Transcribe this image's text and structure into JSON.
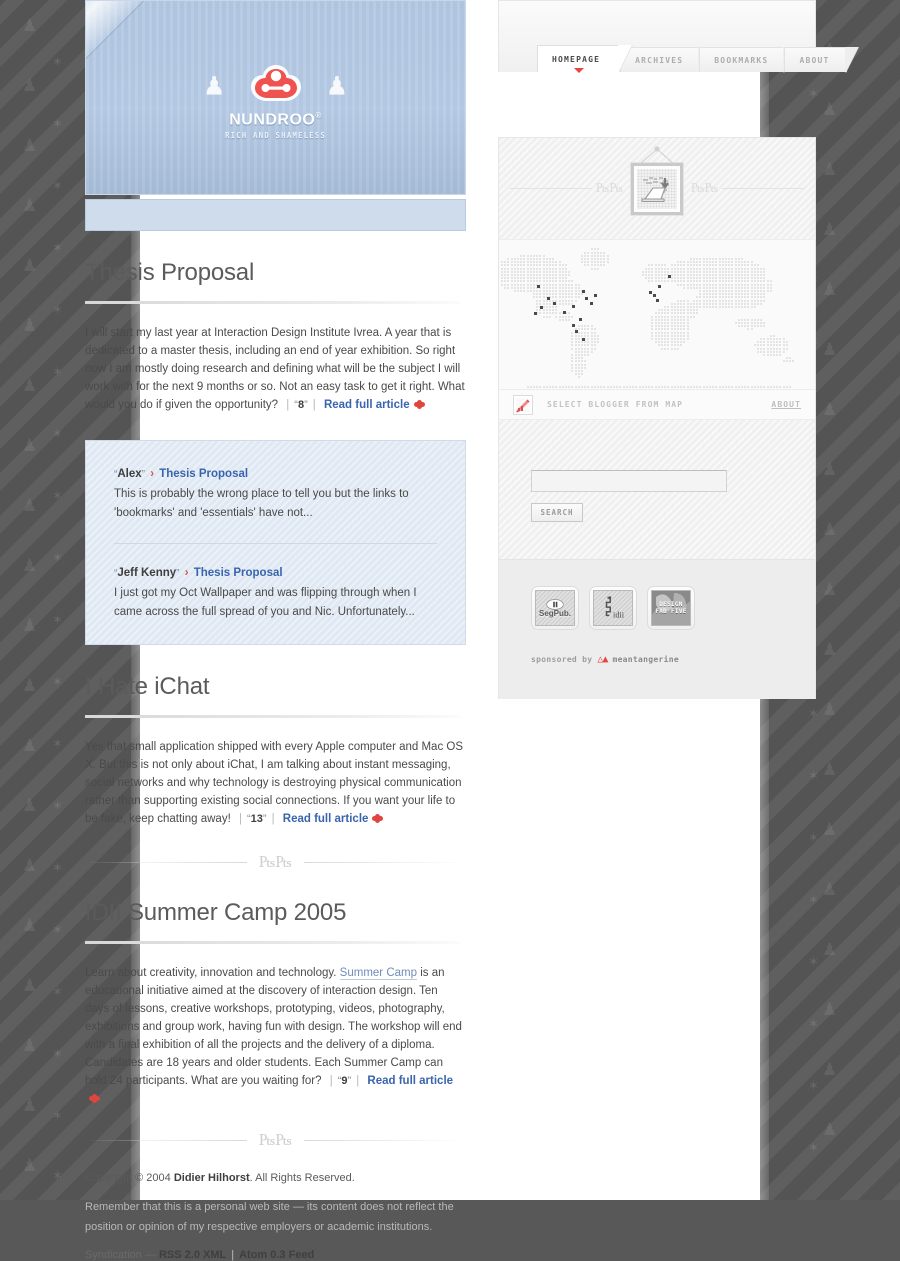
{
  "site": {
    "banner": {
      "logo_name": "NUNDROO",
      "logo_trademark": "®",
      "logo_tagline": "RICH AND SHAMELESS"
    }
  },
  "nav": {
    "tabs": [
      {
        "label": "HOMEPAGE",
        "active": true
      },
      {
        "label": "ARCHIVES",
        "active": false
      },
      {
        "label": "BOOKMARKS",
        "active": false
      },
      {
        "label": "ABOUT",
        "active": false
      }
    ]
  },
  "articles": [
    {
      "title": "Thesis Proposal",
      "body": "I will start my last year at Interaction Design Institute Ivrea. A year that is dedicated to a master thesis, including an end of year exhibition. So right now I am mostly doing research and defining what will be the subject I will work with for the next 9 months or so. Not an easy task to get it right. What would you do if given the opportunity?",
      "comment_count": "8",
      "read_more": "Read full article"
    },
    {
      "title": "I Hate iChat",
      "body": "Yes that small application shipped with every Apple computer and Mac OS X. But this is not only about iChat, I am talking about instant messaging, social networks and why technology is destroying physical communication rather than supporting existing social connections. If you want your life to be fake, keep chatting away!",
      "comment_count": "13",
      "read_more": "Read full article"
    },
    {
      "title": "IDII Summer Camp 2005",
      "body_part1": "Learn about creativity, innovation and technology. ",
      "body_link": "Summer Camp",
      "body_part2": " is an educational initiative aimed at the discovery of interaction design. Ten days of lessons, creative workshops, prototyping, videos, photography, exhibitions and group work, having fun with design. The workshop will end with a final exhibition of all the projects and the delivery of a diploma. Candidates are 18 years and older students. Each Summer Camp can hold 24 participants. What are you waiting for?",
      "comment_count": "9",
      "read_more": "Read full article"
    }
  ],
  "comments": [
    {
      "author": "Alex",
      "arrow": "›",
      "post": "Thesis Proposal",
      "excerpt": "This is probably the wrong place to tell you but the links to 'bookmarks' and 'essentials' have not..."
    },
    {
      "author": "Jeff Kenny",
      "arrow": "›",
      "post": "Thesis Proposal",
      "excerpt": "I just got my Oct Wallpaper and was flipping through when I came across the full spread of you and Nic. Unfortunately..."
    }
  ],
  "footer": {
    "copyright_prefix": "Copyright © 2004 ",
    "copyright_name": "Didier Hilhorst",
    "copyright_suffix": ". All Rights Reserved.",
    "disclaimer": "Remember that this is a personal web site — its content does not reflect the position or opinion of my respective employers or academic institutions.",
    "syndication_label": "Syndication — ",
    "feed_rss": "RSS 2.0 XML",
    "feed_atom": "Atom 0.3 Feed"
  },
  "sidebar": {
    "map": {
      "bar_label": "SELECT BLOGGER FROM MAP",
      "about_label": "ABOUT"
    },
    "search": {
      "value": "",
      "placeholder": "",
      "button_label": "SEARCH"
    },
    "badges": [
      {
        "name": "segpub-badge",
        "line1": "",
        "line2": "SegPub."
      },
      {
        "name": "idii-badge",
        "line1": "",
        "line2": "idii"
      },
      {
        "name": "design-fab-five-badge",
        "line1": "DESIGN",
        "line2": "FAB FIVE"
      }
    ],
    "sponsor": {
      "prefix": "sponsored by",
      "brand": "meantangerine"
    }
  },
  "colors": {
    "accent_red": "#e8443f",
    "link_blue": "#3a64ad",
    "banner_blue": "#a9c0de",
    "comment_panel": "#dfe8f3",
    "page_bg": "#585858"
  }
}
